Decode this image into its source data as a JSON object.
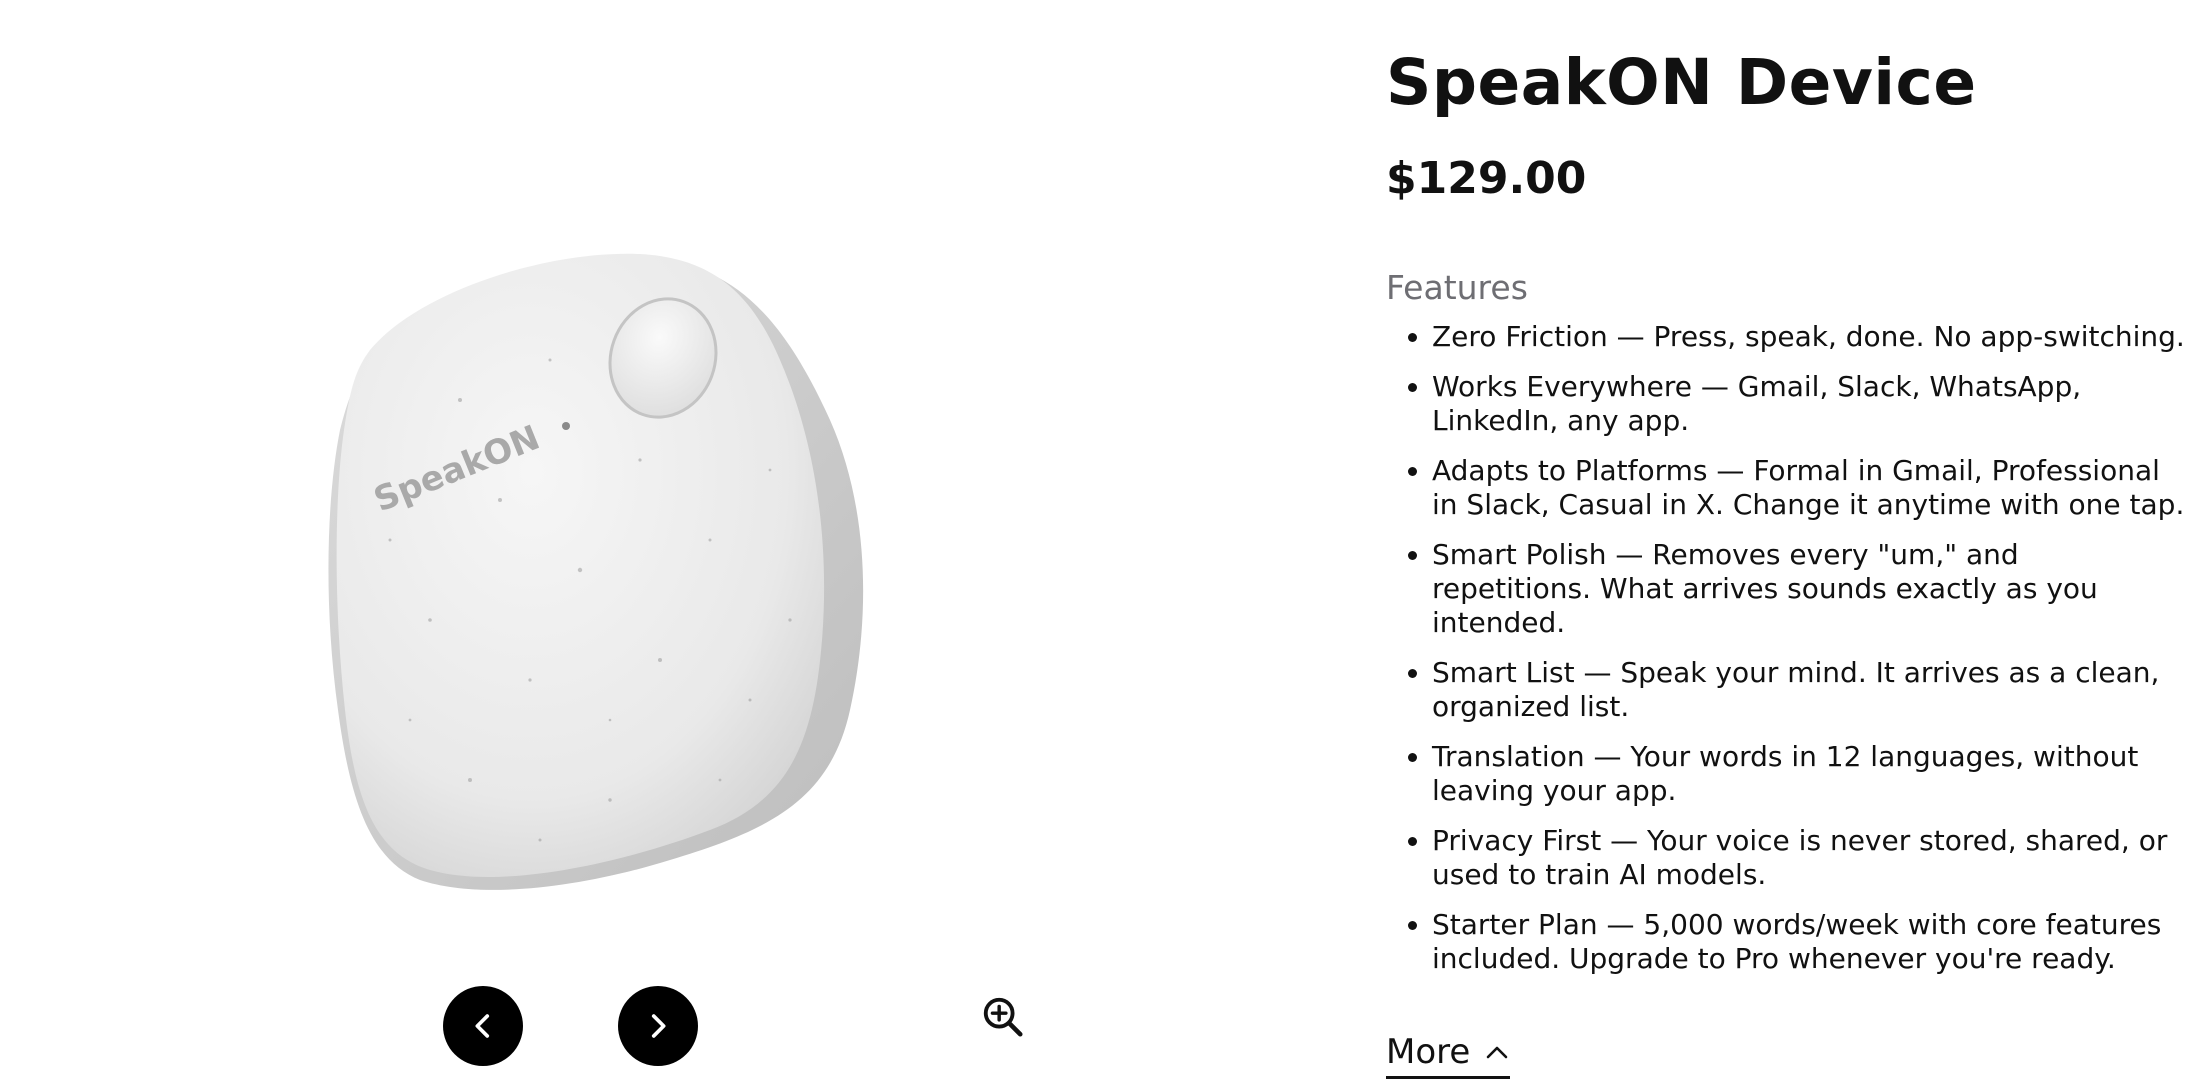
{
  "product": {
    "title": "SpeakON Device",
    "price": "$129.00",
    "image_logo_text": "SpeakON"
  },
  "features": {
    "heading": "Features",
    "items": [
      "Zero Friction — Press, speak, done. No app-switching.",
      "Works Everywhere — Gmail, Slack, WhatsApp, LinkedIn, any app.",
      "Adapts to Platforms — Formal in Gmail, Professional in Slack, Casual in X. Change it anytime with one tap.",
      "Smart Polish — Removes every \"um,\" and repetitions. What arrives sounds exactly as you intended.",
      "Smart List — Speak your mind. It arrives as a clean, organized list.",
      "Translation — Your words in 12 languages, without leaving your app.",
      "Privacy First — Your voice is never stored, shared, or used to train AI models.",
      "Starter Plan — 5,000 words/week with core features included. Upgrade to Pro whenever you're ready."
    ]
  },
  "more": {
    "label": "More",
    "icon": "chevron-up-icon"
  },
  "gallery_controls": {
    "prev_icon": "chevron-left-icon",
    "next_icon": "chevron-right-icon",
    "zoom_icon": "zoom-in-icon"
  },
  "colors": {
    "button_bg": "#000000",
    "device_body": "#ececec",
    "heading_muted": "#6e6e73"
  }
}
